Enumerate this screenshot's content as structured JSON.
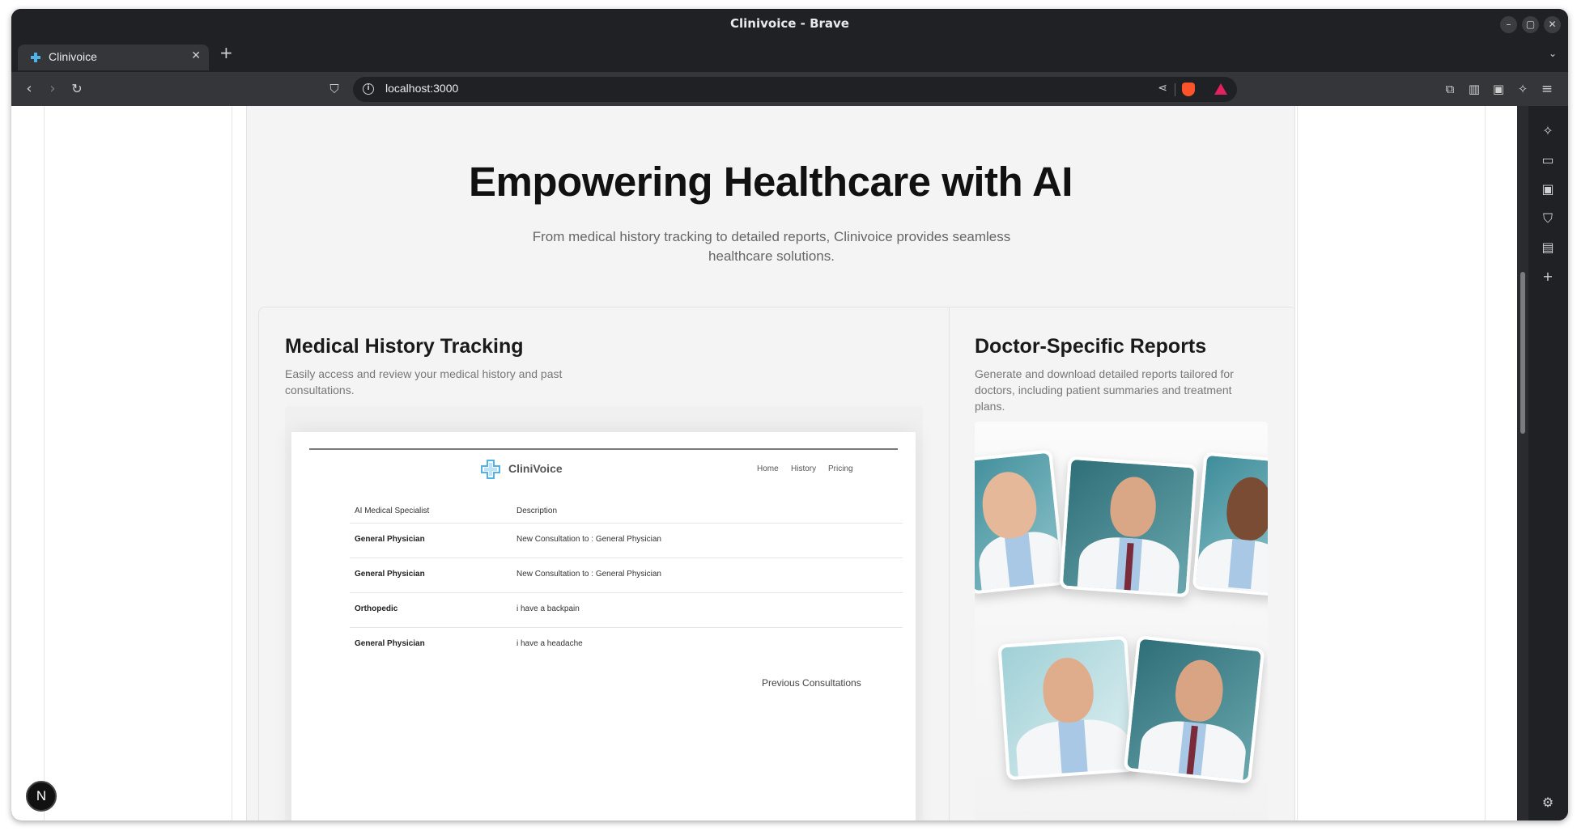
{
  "window": {
    "title": "Clinivoice - Brave"
  },
  "tabs": [
    {
      "title": "Clinivoice"
    }
  ],
  "toolbar": {
    "url": "localhost:3000"
  },
  "hero": {
    "title": "Empowering Healthcare with AI",
    "subtitle": "From medical history tracking to detailed reports, Clinivoice provides seamless healthcare solutions."
  },
  "features": {
    "history": {
      "title": "Medical History Tracking",
      "description": "Easily access and review your medical history and past consultations."
    },
    "reports": {
      "title": "Doctor-Specific Reports",
      "description": "Generate and download detailed reports tailored for doctors, including patient summaries and treatment plans."
    }
  },
  "mock_app": {
    "brand": "CliniVoice",
    "nav": [
      "Home",
      "History",
      "Pricing"
    ],
    "columns": [
      "AI Medical Specialist",
      "Description"
    ],
    "rows": [
      {
        "specialist": "General Physician",
        "description": "New Consultation to : General Physician"
      },
      {
        "specialist": "General Physician",
        "description": "New Consultation to : General Physician"
      },
      {
        "specialist": "Orthopedic",
        "description": "i have a backpain"
      },
      {
        "specialist": "General Physician",
        "description": "i have a headache"
      }
    ],
    "footer_label": "Previous Consultations"
  },
  "dev_badge": {
    "label": "N"
  },
  "colors": {
    "accent_brave": "#fb542b",
    "page_panel": "#f4f4f4",
    "logo": "#4fb3e8"
  }
}
